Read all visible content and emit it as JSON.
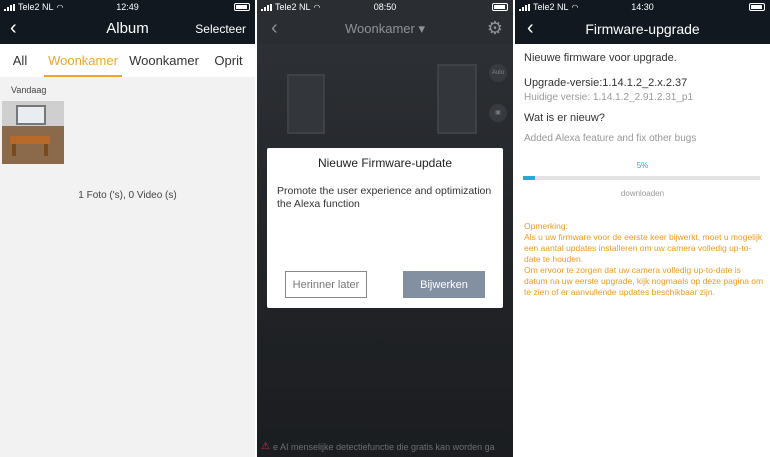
{
  "panel_album": {
    "status": {
      "carrier": "Tele2 NL",
      "time": "12:49"
    },
    "title": "Album",
    "select_label": "Selecteer",
    "tabs": [
      {
        "label": "All",
        "active": false
      },
      {
        "label": "Woonkamer",
        "active": true
      },
      {
        "label": "Woonkamer",
        "active": false
      },
      {
        "label": "Oprit",
        "active": false
      }
    ],
    "section_date": "Vandaag",
    "counts": "1 Foto ('s), 0 Video (s)"
  },
  "panel_live": {
    "status": {
      "carrier": "Tele2 NL",
      "time": "08:50"
    },
    "camera_name": "Woonkamer",
    "side_buttons": [
      "Auto"
    ],
    "dialog": {
      "title": "Nieuwe Firmware-update",
      "body": "Promote the user experience and optimization the Alexa function",
      "later_button": "Herinner later",
      "update_button": "Bijwerken"
    },
    "bottom_note": "e AI menselijke detectiefunctie die gratis kan worden ga"
  },
  "panel_firmware": {
    "status": {
      "carrier": "Tele2 NL",
      "time": "14:30"
    },
    "title": "Firmware-upgrade",
    "new_firmware": "Nieuwe firmware voor upgrade.",
    "upgrade_version": "Upgrade-versie:1.14.1.2_2.x.2.37",
    "current_version": "Huidige versie: 1.14.1.2_2.91.2.31_p1",
    "whats_new_label": "Wat is er nieuw?",
    "whats_new_text": "Added Alexa feature and fix other bugs",
    "progress_label": "5%",
    "progress_value": 0.05,
    "progress_status": "downloaden",
    "note": "Opmerking:\n Als u uw firmware voor de eerste keer bijwerkt, moet u mogelijk een aantal updates installeren om uw camera volledig up-to-date te houden.\n Om ervoor te zorgen dat uw camera volledig up-to-date is datum na uw eerste upgrade, kijk nogmaals op deze pagina om te zien of er aanvullende updates beschikbaar zijn."
  },
  "colors": {
    "accent": "#f2a52a",
    "progress": "#29a8d8",
    "note": "#f29a1a",
    "navbar": "#11181f",
    "update_button": "#8390a2"
  },
  "icons": [
    "back-chevron-icon",
    "settings-gear-icon",
    "signal-icon",
    "wifi-icon",
    "battery-icon",
    "warning-icon"
  ]
}
